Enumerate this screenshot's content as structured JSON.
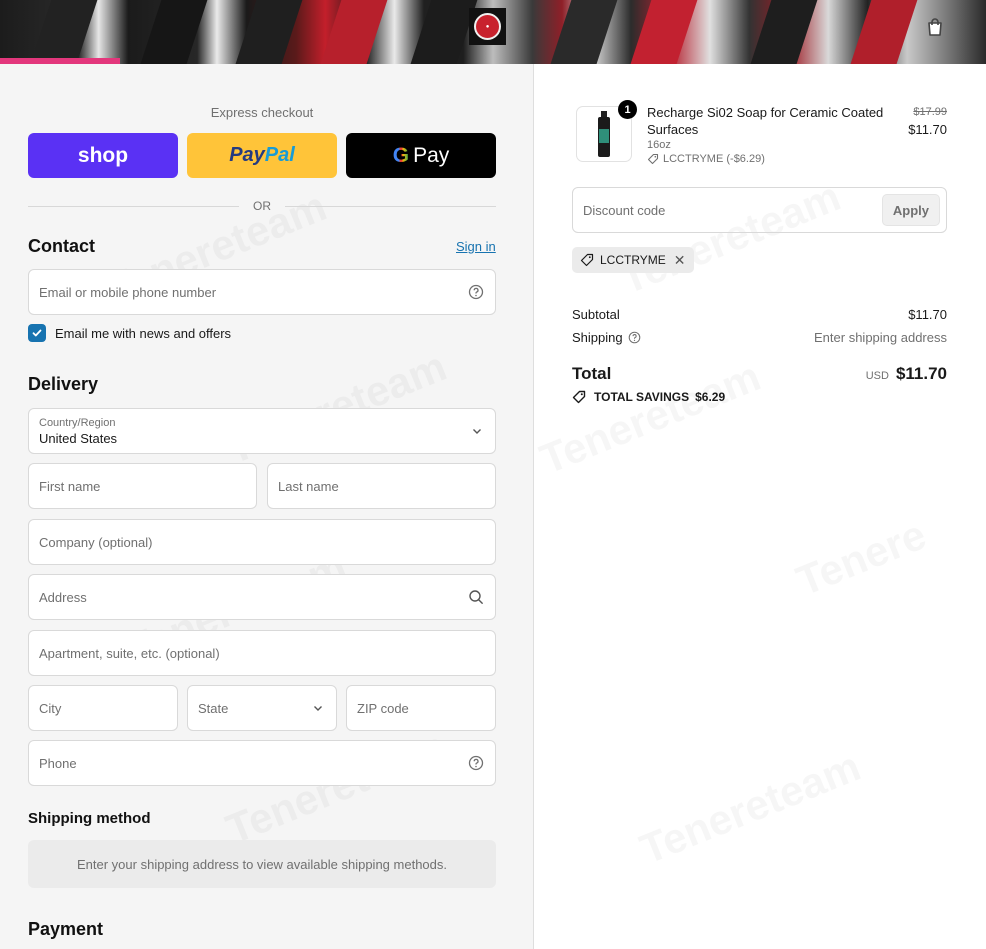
{
  "header": {
    "logo_alt": "store-logo",
    "icons": {
      "logo": "brand-logo-icon",
      "bag": "shopping-bag-icon"
    }
  },
  "express": {
    "label": "Express checkout",
    "shop_label": "shop",
    "paypal_label_1": "Pay",
    "paypal_label_2": "Pal",
    "gpay_g": "G",
    "gpay_label": "Pay",
    "or_label": "OR"
  },
  "contact": {
    "title": "Contact",
    "sign_in": "Sign in",
    "email_placeholder": "Email or mobile phone number",
    "newsletter_label": "Email me with news and offers",
    "newsletter_checked": true
  },
  "delivery": {
    "title": "Delivery",
    "country_label": "Country/Region",
    "country_value": "United States",
    "first_name": "First name",
    "last_name": "Last name",
    "company": "Company (optional)",
    "address": "Address",
    "apartment": "Apartment, suite, etc. (optional)",
    "city": "City",
    "state": "State",
    "zip": "ZIP code",
    "phone": "Phone"
  },
  "shipping_method": {
    "title": "Shipping method",
    "message": "Enter your shipping address to view available shipping methods."
  },
  "payment": {
    "title": "Payment"
  },
  "order": {
    "item": {
      "name": "Recharge Si02 Soap for Ceramic Coated Surfaces",
      "variant": "16oz",
      "discount": "LCCTRYME (-$6.29)",
      "quantity": "1",
      "price_original": "$17.99",
      "price_final": "$11.70"
    },
    "discount_placeholder": "Discount code",
    "apply_label": "Apply",
    "applied_code": "LCCTRYME",
    "subtotal_label": "Subtotal",
    "subtotal_value": "$11.70",
    "shipping_label": "Shipping",
    "shipping_value": "Enter shipping address",
    "total_label": "Total",
    "currency": "USD",
    "total_value": "$11.70",
    "savings_label": "TOTAL SAVINGS",
    "savings_value": "$6.29"
  },
  "colors": {
    "accent": "#1773b0",
    "shop_purple": "#5a31f4",
    "paypal_yellow": "#ffc439",
    "gpay_black": "#000000"
  }
}
